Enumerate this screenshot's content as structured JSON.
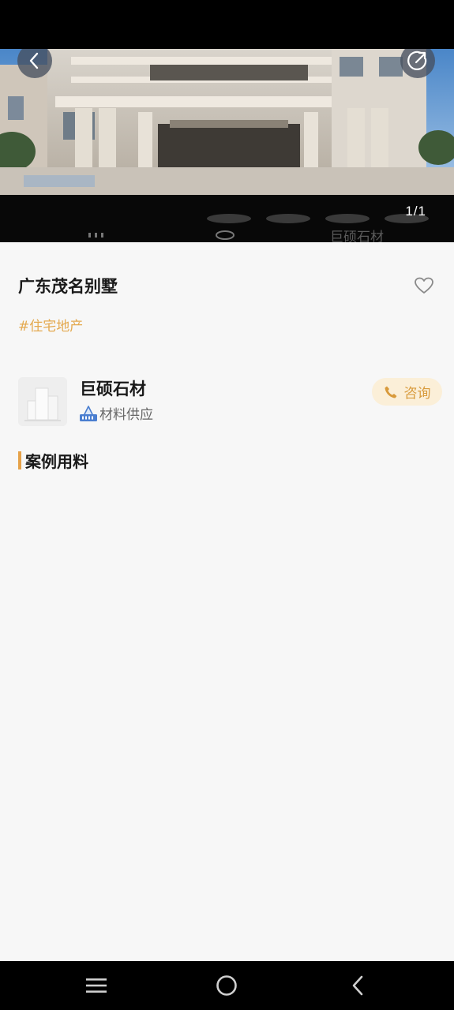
{
  "gallery": {
    "counter": "1/1",
    "watermark": "巨硕石材"
  },
  "project": {
    "title": "广东茂名别墅",
    "tag": "#住宅地产"
  },
  "supplier": {
    "name": "巨硕石材",
    "type": "材料供应",
    "consult_label": "咨询"
  },
  "section": {
    "title": "案例用料"
  },
  "colors": {
    "accent": "#e6a24a",
    "tag_text": "#e4a94f",
    "consult_bg": "#fbefd8"
  },
  "icons": [
    "back-icon",
    "share-icon",
    "heart-icon",
    "building-placeholder-icon",
    "supplier-badge-icon",
    "phone-icon",
    "menu-icon",
    "home-icon",
    "nav-back-icon"
  ]
}
